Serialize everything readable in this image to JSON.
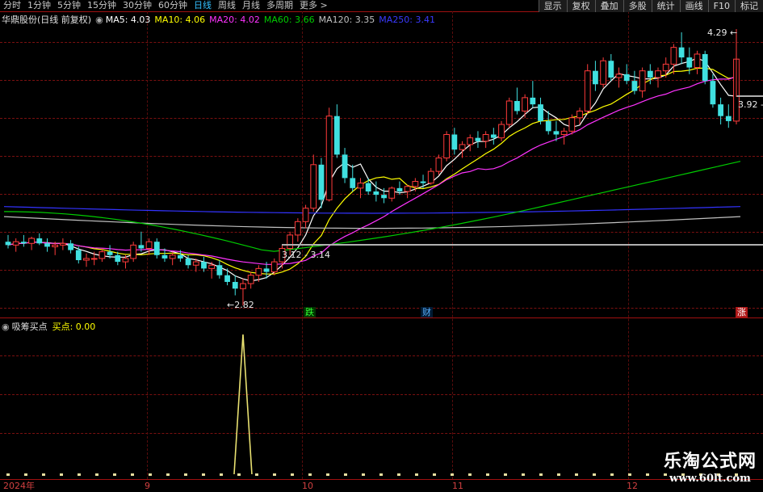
{
  "toolbar": {
    "tabs": [
      "分时",
      "1分钟",
      "5分钟",
      "15分钟",
      "30分钟",
      "60分钟",
      "日线",
      "周线",
      "月线",
      "多周期",
      "更多 >"
    ],
    "active_tab": "日线",
    "right_buttons": [
      "显示",
      "复权",
      "叠加",
      "多股",
      "统计",
      "画线",
      "F10",
      "标记"
    ]
  },
  "quote": {
    "title": "华鼎股份(日线 前复权)",
    "ma5": "MA5: 4.03",
    "ma10": "MA10: 4.06",
    "ma20": "MA20: 4.02",
    "ma60": "MA60: 3.66",
    "ma120": "MA120: 3.35",
    "ma250": "MA250: 3.41"
  },
  "colors": {
    "up": "#ff3b3b",
    "down": "#40e0e0",
    "ma5": "#ffffff",
    "ma10": "#ffff00",
    "ma20": "#ff33ff",
    "ma60": "#00cc00",
    "ma120": "#c0c0c0",
    "ma250": "#3333ff",
    "grid": "#7a1010"
  },
  "annotations": {
    "high_label": "4.29",
    "low_label": "2.82",
    "range_label": "3.12 - 3.14",
    "last_label": "3.92 -",
    "marker_die": "跌",
    "marker_cai": "财",
    "marker_zhang": "涨"
  },
  "indicator": {
    "name": "吸筹买点",
    "value_label": "买点: 0.00"
  },
  "axis": {
    "x_labels": [
      "2024年",
      "9",
      "10",
      "11",
      "12"
    ]
  },
  "watermark": {
    "line1": "乐淘公式网",
    "line2": "www.60lt.com"
  },
  "chart_data": {
    "type": "candlestick",
    "title": "华鼎股份(日线 前复权)",
    "price_labels": {
      "high": 4.29,
      "low": 2.82,
      "range": [
        3.12,
        3.14
      ],
      "last": 3.92
    },
    "moving_averages": {
      "MA5": 4.03,
      "MA10": 4.06,
      "MA20": 4.02,
      "MA60": 3.66,
      "MA120": 3.35,
      "MA250": 3.41
    },
    "ohlc": [
      [
        3.2,
        3.24,
        3.16,
        3.18
      ],
      [
        3.18,
        3.22,
        3.14,
        3.2
      ],
      [
        3.2,
        3.24,
        3.17,
        3.19
      ],
      [
        3.19,
        3.23,
        3.15,
        3.22
      ],
      [
        3.22,
        3.25,
        3.18,
        3.19
      ],
      [
        3.19,
        3.22,
        3.14,
        3.17
      ],
      [
        3.17,
        3.2,
        3.12,
        3.18
      ],
      [
        3.18,
        3.22,
        3.15,
        3.19
      ],
      [
        3.19,
        3.21,
        3.13,
        3.15
      ],
      [
        3.15,
        3.17,
        3.07,
        3.09
      ],
      [
        3.09,
        3.13,
        3.05,
        3.1
      ],
      [
        3.1,
        3.14,
        3.06,
        3.1
      ],
      [
        3.1,
        3.16,
        3.08,
        3.14
      ],
      [
        3.14,
        3.18,
        3.1,
        3.12
      ],
      [
        3.12,
        3.14,
        3.06,
        3.08
      ],
      [
        3.08,
        3.12,
        3.04,
        3.1
      ],
      [
        3.1,
        3.2,
        3.08,
        3.18
      ],
      [
        3.18,
        3.26,
        3.14,
        3.16
      ],
      [
        3.16,
        3.22,
        3.12,
        3.2
      ],
      [
        3.2,
        3.22,
        3.1,
        3.12
      ],
      [
        3.12,
        3.16,
        3.08,
        3.1
      ],
      [
        3.1,
        3.14,
        3.06,
        3.12
      ],
      [
        3.12,
        3.15,
        3.08,
        3.1
      ],
      [
        3.1,
        3.12,
        3.04,
        3.06
      ],
      [
        3.06,
        3.1,
        3.02,
        3.08
      ],
      [
        3.08,
        3.11,
        3.02,
        3.04
      ],
      [
        3.04,
        3.08,
        2.98,
        3.06
      ],
      [
        3.06,
        3.09,
        2.98,
        3.0
      ],
      [
        3.0,
        3.04,
        2.94,
        2.96
      ],
      [
        2.96,
        3.0,
        2.88,
        2.92
      ],
      [
        2.92,
        2.98,
        2.82,
        2.95
      ],
      [
        2.95,
        3.02,
        2.92,
        3.0
      ],
      [
        3.0,
        3.06,
        2.96,
        3.04
      ],
      [
        3.04,
        3.08,
        2.98,
        3.02
      ],
      [
        3.02,
        3.1,
        3.0,
        3.08
      ],
      [
        3.08,
        3.18,
        3.04,
        3.16
      ],
      [
        3.16,
        3.26,
        3.12,
        3.24
      ],
      [
        3.24,
        3.34,
        3.2,
        3.32
      ],
      [
        3.32,
        3.42,
        3.28,
        3.4
      ],
      [
        3.4,
        3.72,
        3.38,
        3.66
      ],
      [
        3.66,
        3.7,
        3.4,
        3.45
      ],
      [
        3.45,
        4.0,
        3.44,
        3.95
      ],
      [
        3.95,
        4.02,
        3.7,
        3.72
      ],
      [
        3.72,
        3.76,
        3.55,
        3.58
      ],
      [
        3.58,
        3.66,
        3.5,
        3.52
      ],
      [
        3.52,
        3.58,
        3.46,
        3.55
      ],
      [
        3.55,
        3.58,
        3.48,
        3.5
      ],
      [
        3.5,
        3.56,
        3.44,
        3.48
      ],
      [
        3.48,
        3.52,
        3.43,
        3.46
      ],
      [
        3.46,
        3.53,
        3.44,
        3.52
      ],
      [
        3.52,
        3.56,
        3.48,
        3.5
      ],
      [
        3.5,
        3.54,
        3.46,
        3.53
      ],
      [
        3.53,
        3.58,
        3.5,
        3.56
      ],
      [
        3.56,
        3.6,
        3.52,
        3.55
      ],
      [
        3.55,
        3.64,
        3.54,
        3.62
      ],
      [
        3.62,
        3.72,
        3.6,
        3.7
      ],
      [
        3.7,
        3.86,
        3.68,
        3.84
      ],
      [
        3.84,
        3.88,
        3.72,
        3.75
      ],
      [
        3.75,
        3.8,
        3.7,
        3.78
      ],
      [
        3.78,
        3.84,
        3.74,
        3.82
      ],
      [
        3.82,
        3.86,
        3.76,
        3.8
      ],
      [
        3.8,
        3.86,
        3.76,
        3.84
      ],
      [
        3.84,
        3.88,
        3.78,
        3.82
      ],
      [
        3.82,
        3.92,
        3.8,
        3.9
      ],
      [
        3.9,
        4.06,
        3.88,
        4.04
      ],
      [
        4.04,
        4.12,
        3.96,
        3.98
      ],
      [
        3.98,
        4.08,
        3.94,
        4.06
      ],
      [
        4.06,
        4.16,
        4.0,
        4.02
      ],
      [
        4.02,
        4.06,
        3.9,
        3.92
      ],
      [
        3.92,
        3.98,
        3.84,
        3.86
      ],
      [
        3.86,
        3.92,
        3.8,
        3.84
      ],
      [
        3.84,
        3.88,
        3.78,
        3.86
      ],
      [
        3.86,
        3.96,
        3.84,
        3.94
      ],
      [
        3.94,
        4.0,
        3.9,
        3.98
      ],
      [
        3.98,
        4.26,
        3.96,
        4.22
      ],
      [
        4.22,
        4.28,
        4.1,
        4.14
      ],
      [
        4.14,
        4.3,
        4.12,
        4.28
      ],
      [
        4.28,
        4.32,
        4.16,
        4.18
      ],
      [
        4.18,
        4.24,
        4.12,
        4.2
      ],
      [
        4.2,
        4.26,
        4.14,
        4.16
      ],
      [
        4.16,
        4.22,
        4.08,
        4.1
      ],
      [
        4.1,
        4.24,
        4.06,
        4.22
      ],
      [
        4.22,
        4.26,
        4.14,
        4.18
      ],
      [
        4.18,
        4.24,
        4.12,
        4.22
      ],
      [
        4.22,
        4.3,
        4.18,
        4.26
      ],
      [
        4.26,
        4.38,
        4.2,
        4.36
      ],
      [
        4.36,
        4.45,
        4.26,
        4.3
      ],
      [
        4.3,
        4.36,
        4.2,
        4.24
      ],
      [
        4.24,
        4.34,
        4.2,
        4.32
      ],
      [
        4.32,
        4.34,
        4.14,
        4.16
      ],
      [
        4.16,
        4.2,
        4.0,
        4.02
      ],
      [
        4.02,
        4.06,
        3.9,
        3.95
      ],
      [
        3.95,
        4.02,
        3.88,
        3.92
      ],
      [
        3.92,
        4.29,
        3.9,
        4.29
      ]
    ],
    "indicator_series": {
      "name": "吸筹买点",
      "spike_index": 30,
      "spike_value": 1,
      "baseline": 0
    }
  }
}
